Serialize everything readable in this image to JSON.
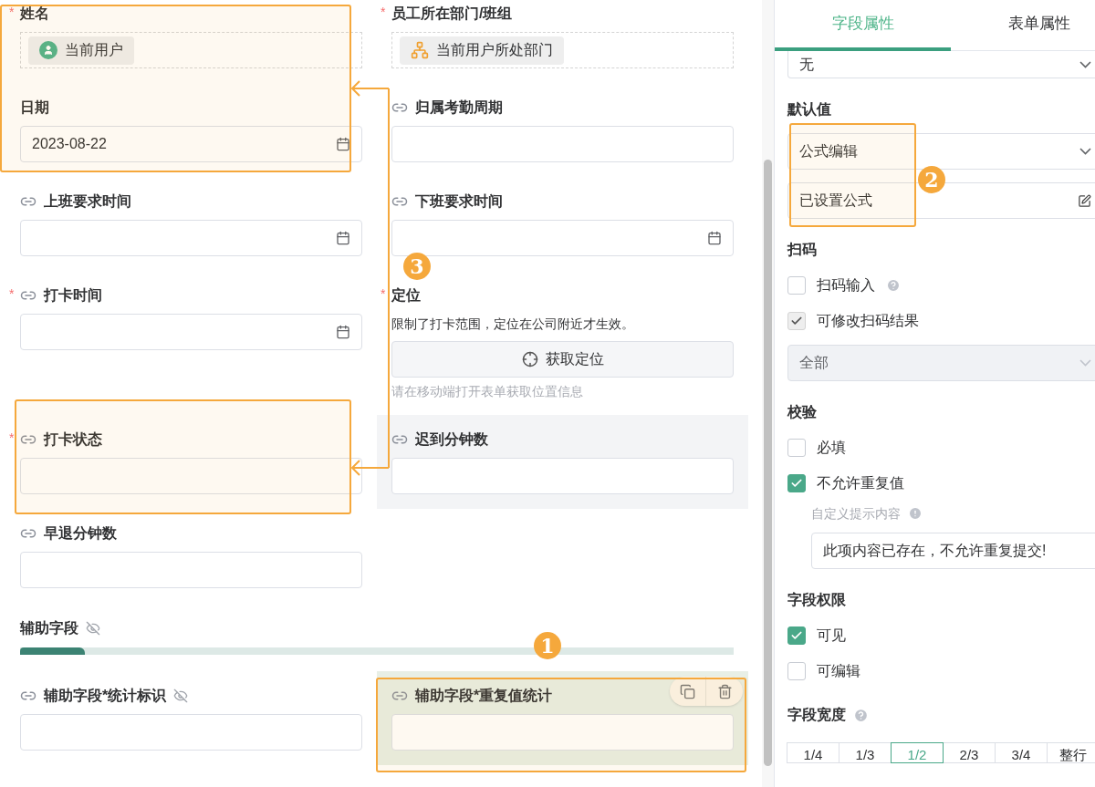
{
  "required_mark": "*",
  "form": {
    "rows": [
      {
        "kind": "fields",
        "cells": [
          {
            "label": "姓名",
            "required": true,
            "linked": false,
            "kind": "member",
            "value": "当前用户"
          },
          {
            "label": "员工所在部门/班组",
            "required": true,
            "linked": false,
            "kind": "department",
            "value": "当前用户所处部门"
          }
        ]
      },
      {
        "kind": "fields",
        "cells": [
          {
            "label": "日期",
            "required": false,
            "linked": false,
            "kind": "date",
            "value": "2023-08-22"
          },
          {
            "label": "归属考勤周期",
            "required": false,
            "linked": true,
            "kind": "text"
          }
        ]
      },
      {
        "kind": "fields",
        "cells": [
          {
            "label": "上班要求时间",
            "required": false,
            "linked": true,
            "kind": "date"
          },
          {
            "label": "下班要求时间",
            "required": false,
            "linked": true,
            "kind": "date"
          }
        ]
      },
      {
        "kind": "fields",
        "cells": [
          {
            "label": "打卡时间",
            "required": true,
            "linked": true,
            "kind": "date"
          },
          {
            "label": "定位",
            "required": true,
            "linked": false,
            "kind": "location",
            "note": "限制了打卡范围，定位在公司附近才生效。",
            "button": "获取定位",
            "help": "请在移动端打开表单获取位置信息"
          }
        ]
      },
      {
        "kind": "fields",
        "cells": [
          {
            "label": "打卡状态",
            "required": true,
            "linked": true,
            "kind": "text"
          },
          {
            "label": "迟到分钟数",
            "required": false,
            "linked": true,
            "kind": "text",
            "hovered": true
          }
        ]
      },
      {
        "kind": "fields",
        "cells": [
          {
            "label": "早退分钟数",
            "required": false,
            "linked": true,
            "kind": "text"
          }
        ]
      },
      {
        "kind": "section",
        "title": "辅助字段",
        "hidden": true
      },
      {
        "kind": "fields",
        "cells": [
          {
            "label": "辅助字段*统计标识",
            "required": false,
            "linked": true,
            "kind": "text",
            "hidden": true
          },
          {
            "label": "辅助字段*重复值统计",
            "required": false,
            "linked": true,
            "kind": "text",
            "selected": true
          }
        ]
      }
    ]
  },
  "panel": {
    "tabs": [
      {
        "label": "字段属性",
        "selected": true
      },
      {
        "label": "表单属性",
        "selected": false
      }
    ],
    "items": [
      {
        "kind": "select",
        "value": "无",
        "disabled": false
      },
      {
        "kind": "heading",
        "text": "默认值"
      },
      {
        "kind": "select",
        "value": "公式编辑",
        "disabled": false
      },
      {
        "kind": "formula",
        "value": "已设置公式"
      },
      {
        "kind": "heading",
        "text": "扫码"
      },
      {
        "kind": "checkbox",
        "label": "扫码输入",
        "checked": false,
        "disabled": false,
        "help": true
      },
      {
        "kind": "checkbox",
        "label": "可修改扫码结果",
        "checked": true,
        "disabled": true,
        "help": false
      },
      {
        "kind": "select",
        "value": "全部",
        "disabled": true
      },
      {
        "kind": "heading",
        "text": "校验"
      },
      {
        "kind": "checkbox",
        "label": "必填",
        "checked": false,
        "disabled": false,
        "help": false
      },
      {
        "kind": "checkbox",
        "label": "不允许重复值",
        "checked": true,
        "disabled": false,
        "help": false
      },
      {
        "kind": "hint",
        "text": "自定义提示内容"
      },
      {
        "kind": "input",
        "value": "此项内容已存在，不允许重复提交!"
      },
      {
        "kind": "heading",
        "text": "字段权限"
      },
      {
        "kind": "checkbox",
        "label": "可见",
        "checked": true,
        "disabled": false,
        "help": false
      },
      {
        "kind": "checkbox",
        "label": "可编辑",
        "checked": false,
        "disabled": false,
        "help": false
      },
      {
        "kind": "heading",
        "text": "字段宽度",
        "help": true
      },
      {
        "kind": "segmented",
        "options": [
          {
            "label": "1/4",
            "selected": false
          },
          {
            "label": "1/3",
            "selected": false
          },
          {
            "label": "1/2",
            "selected": true
          },
          {
            "label": "2/3",
            "selected": false
          },
          {
            "label": "3/4",
            "selected": false
          },
          {
            "label": "整行",
            "selected": false
          }
        ]
      }
    ]
  },
  "annotation_markers": [
    {
      "label": "1"
    },
    {
      "label": "2"
    },
    {
      "label": "3"
    }
  ]
}
